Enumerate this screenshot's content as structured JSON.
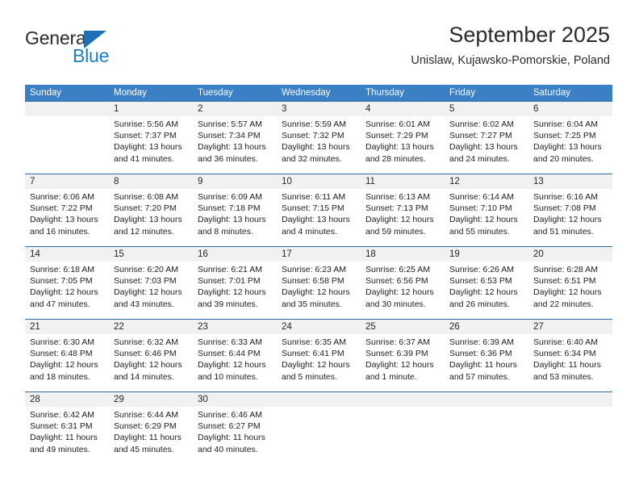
{
  "brand": {
    "name_top": "General",
    "name_bottom": "Blue",
    "color_dark": "#2b2b2b",
    "color_blue": "#1b7dc4"
  },
  "header": {
    "title": "September 2025",
    "subtitle": "Unislaw, Kujawsko-Pomorskie, Poland"
  },
  "theme": {
    "header_blue": "#3b7fc4",
    "rule_blue": "#2e6da4",
    "daynum_band": "#f1f1f1",
    "text": "#1c1c1c"
  },
  "weekdays": [
    "Sunday",
    "Monday",
    "Tuesday",
    "Wednesday",
    "Thursday",
    "Friday",
    "Saturday"
  ],
  "weeks": [
    [
      {
        "day": "",
        "sunrise": "",
        "sunset": "",
        "daylight_1": "",
        "daylight_2": ""
      },
      {
        "day": "1",
        "sunrise": "Sunrise: 5:56 AM",
        "sunset": "Sunset: 7:37 PM",
        "daylight_1": "Daylight: 13 hours",
        "daylight_2": "and 41 minutes."
      },
      {
        "day": "2",
        "sunrise": "Sunrise: 5:57 AM",
        "sunset": "Sunset: 7:34 PM",
        "daylight_1": "Daylight: 13 hours",
        "daylight_2": "and 36 minutes."
      },
      {
        "day": "3",
        "sunrise": "Sunrise: 5:59 AM",
        "sunset": "Sunset: 7:32 PM",
        "daylight_1": "Daylight: 13 hours",
        "daylight_2": "and 32 minutes."
      },
      {
        "day": "4",
        "sunrise": "Sunrise: 6:01 AM",
        "sunset": "Sunset: 7:29 PM",
        "daylight_1": "Daylight: 13 hours",
        "daylight_2": "and 28 minutes."
      },
      {
        "day": "5",
        "sunrise": "Sunrise: 6:02 AM",
        "sunset": "Sunset: 7:27 PM",
        "daylight_1": "Daylight: 13 hours",
        "daylight_2": "and 24 minutes."
      },
      {
        "day": "6",
        "sunrise": "Sunrise: 6:04 AM",
        "sunset": "Sunset: 7:25 PM",
        "daylight_1": "Daylight: 13 hours",
        "daylight_2": "and 20 minutes."
      }
    ],
    [
      {
        "day": "7",
        "sunrise": "Sunrise: 6:06 AM",
        "sunset": "Sunset: 7:22 PM",
        "daylight_1": "Daylight: 13 hours",
        "daylight_2": "and 16 minutes."
      },
      {
        "day": "8",
        "sunrise": "Sunrise: 6:08 AM",
        "sunset": "Sunset: 7:20 PM",
        "daylight_1": "Daylight: 13 hours",
        "daylight_2": "and 12 minutes."
      },
      {
        "day": "9",
        "sunrise": "Sunrise: 6:09 AM",
        "sunset": "Sunset: 7:18 PM",
        "daylight_1": "Daylight: 13 hours",
        "daylight_2": "and 8 minutes."
      },
      {
        "day": "10",
        "sunrise": "Sunrise: 6:11 AM",
        "sunset": "Sunset: 7:15 PM",
        "daylight_1": "Daylight: 13 hours",
        "daylight_2": "and 4 minutes."
      },
      {
        "day": "11",
        "sunrise": "Sunrise: 6:13 AM",
        "sunset": "Sunset: 7:13 PM",
        "daylight_1": "Daylight: 12 hours",
        "daylight_2": "and 59 minutes."
      },
      {
        "day": "12",
        "sunrise": "Sunrise: 6:14 AM",
        "sunset": "Sunset: 7:10 PM",
        "daylight_1": "Daylight: 12 hours",
        "daylight_2": "and 55 minutes."
      },
      {
        "day": "13",
        "sunrise": "Sunrise: 6:16 AM",
        "sunset": "Sunset: 7:08 PM",
        "daylight_1": "Daylight: 12 hours",
        "daylight_2": "and 51 minutes."
      }
    ],
    [
      {
        "day": "14",
        "sunrise": "Sunrise: 6:18 AM",
        "sunset": "Sunset: 7:05 PM",
        "daylight_1": "Daylight: 12 hours",
        "daylight_2": "and 47 minutes."
      },
      {
        "day": "15",
        "sunrise": "Sunrise: 6:20 AM",
        "sunset": "Sunset: 7:03 PM",
        "daylight_1": "Daylight: 12 hours",
        "daylight_2": "and 43 minutes."
      },
      {
        "day": "16",
        "sunrise": "Sunrise: 6:21 AM",
        "sunset": "Sunset: 7:01 PM",
        "daylight_1": "Daylight: 12 hours",
        "daylight_2": "and 39 minutes."
      },
      {
        "day": "17",
        "sunrise": "Sunrise: 6:23 AM",
        "sunset": "Sunset: 6:58 PM",
        "daylight_1": "Daylight: 12 hours",
        "daylight_2": "and 35 minutes."
      },
      {
        "day": "18",
        "sunrise": "Sunrise: 6:25 AM",
        "sunset": "Sunset: 6:56 PM",
        "daylight_1": "Daylight: 12 hours",
        "daylight_2": "and 30 minutes."
      },
      {
        "day": "19",
        "sunrise": "Sunrise: 6:26 AM",
        "sunset": "Sunset: 6:53 PM",
        "daylight_1": "Daylight: 12 hours",
        "daylight_2": "and 26 minutes."
      },
      {
        "day": "20",
        "sunrise": "Sunrise: 6:28 AM",
        "sunset": "Sunset: 6:51 PM",
        "daylight_1": "Daylight: 12 hours",
        "daylight_2": "and 22 minutes."
      }
    ],
    [
      {
        "day": "21",
        "sunrise": "Sunrise: 6:30 AM",
        "sunset": "Sunset: 6:48 PM",
        "daylight_1": "Daylight: 12 hours",
        "daylight_2": "and 18 minutes."
      },
      {
        "day": "22",
        "sunrise": "Sunrise: 6:32 AM",
        "sunset": "Sunset: 6:46 PM",
        "daylight_1": "Daylight: 12 hours",
        "daylight_2": "and 14 minutes."
      },
      {
        "day": "23",
        "sunrise": "Sunrise: 6:33 AM",
        "sunset": "Sunset: 6:44 PM",
        "daylight_1": "Daylight: 12 hours",
        "daylight_2": "and 10 minutes."
      },
      {
        "day": "24",
        "sunrise": "Sunrise: 6:35 AM",
        "sunset": "Sunset: 6:41 PM",
        "daylight_1": "Daylight: 12 hours",
        "daylight_2": "and 5 minutes."
      },
      {
        "day": "25",
        "sunrise": "Sunrise: 6:37 AM",
        "sunset": "Sunset: 6:39 PM",
        "daylight_1": "Daylight: 12 hours",
        "daylight_2": "and 1 minute."
      },
      {
        "day": "26",
        "sunrise": "Sunrise: 6:39 AM",
        "sunset": "Sunset: 6:36 PM",
        "daylight_1": "Daylight: 11 hours",
        "daylight_2": "and 57 minutes."
      },
      {
        "day": "27",
        "sunrise": "Sunrise: 6:40 AM",
        "sunset": "Sunset: 6:34 PM",
        "daylight_1": "Daylight: 11 hours",
        "daylight_2": "and 53 minutes."
      }
    ],
    [
      {
        "day": "28",
        "sunrise": "Sunrise: 6:42 AM",
        "sunset": "Sunset: 6:31 PM",
        "daylight_1": "Daylight: 11 hours",
        "daylight_2": "and 49 minutes."
      },
      {
        "day": "29",
        "sunrise": "Sunrise: 6:44 AM",
        "sunset": "Sunset: 6:29 PM",
        "daylight_1": "Daylight: 11 hours",
        "daylight_2": "and 45 minutes."
      },
      {
        "day": "30",
        "sunrise": "Sunrise: 6:46 AM",
        "sunset": "Sunset: 6:27 PM",
        "daylight_1": "Daylight: 11 hours",
        "daylight_2": "and 40 minutes."
      },
      {
        "day": "",
        "sunrise": "",
        "sunset": "",
        "daylight_1": "",
        "daylight_2": ""
      },
      {
        "day": "",
        "sunrise": "",
        "sunset": "",
        "daylight_1": "",
        "daylight_2": ""
      },
      {
        "day": "",
        "sunrise": "",
        "sunset": "",
        "daylight_1": "",
        "daylight_2": ""
      },
      {
        "day": "",
        "sunrise": "",
        "sunset": "",
        "daylight_1": "",
        "daylight_2": ""
      }
    ]
  ]
}
